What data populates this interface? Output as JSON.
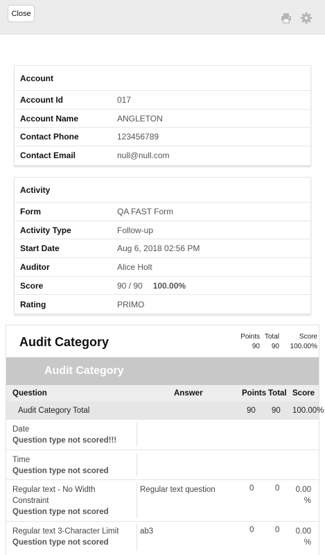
{
  "toolbar": {
    "close_label": "Close",
    "icons": [
      "printer-icon",
      "gear-icon"
    ]
  },
  "account": {
    "header": "Account",
    "rows": [
      {
        "label": "Account Id",
        "value": "017"
      },
      {
        "label": "Account Name",
        "value": "ANGLETON"
      },
      {
        "label": "Contact Phone",
        "value": "123456789"
      },
      {
        "label": "Contact Email",
        "value": "null@null.com"
      }
    ]
  },
  "activity": {
    "header": "Activity",
    "form_label": "Form",
    "form_value": "QA FAST Form",
    "type_label": "Activity Type",
    "type_value": "Follow-up",
    "start_label": "Start Date",
    "start_value": "Aug 6, 2018 02:56 PM",
    "auditor_label": "Auditor",
    "auditor_value": "Alice Holt",
    "score_label": "Score",
    "score_value": "90 / 90",
    "score_percent": "100.00%",
    "rating_label": "Rating",
    "rating_value": "PRIMO"
  },
  "audit": {
    "title": "Audit Category",
    "summary": {
      "points_label": "Points",
      "points_value": "90",
      "total_label": "Total",
      "total_value": "90",
      "score_label": "Score",
      "score_value": "100.00%"
    },
    "band_title": "Audit Category",
    "columns": {
      "question": "Question",
      "answer": "Answer",
      "points": "Points",
      "total": "Total",
      "score": "Score"
    },
    "category_total": {
      "label": "Audit Category Total",
      "points": "90",
      "total": "90",
      "score": "100.00%"
    },
    "questions": [
      {
        "question": "Date",
        "note": "Question type not scored!!!",
        "answer": "",
        "points": "",
        "total": "",
        "score": ""
      },
      {
        "question": "Time",
        "note": "Question type not scored",
        "answer": "",
        "points": "",
        "total": "",
        "score": ""
      },
      {
        "question": "Regular text - No Width Constraint",
        "note": "Question type not scored",
        "answer": "Regular text question",
        "points": "0",
        "total": "0",
        "score": "0.00 %"
      },
      {
        "question": "Regular text 3-Character Limit",
        "note": "Question type not scored",
        "answer": "ab3",
        "points": "0",
        "total": "0",
        "score": "0.00 %"
      }
    ]
  },
  "colors": {
    "topbar": "#ececec",
    "band": "#c8c8c8",
    "table_header": "#ededed"
  }
}
